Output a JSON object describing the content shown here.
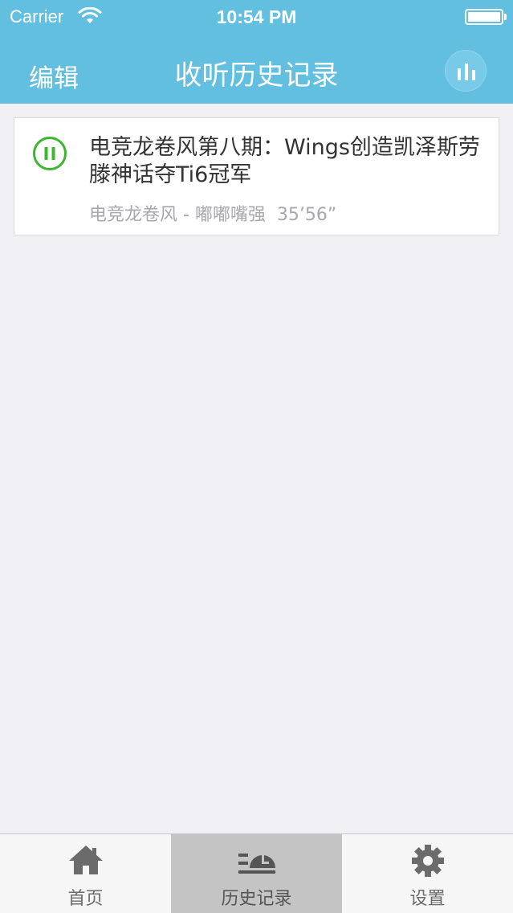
{
  "status_bar": {
    "carrier": "Carrier",
    "time": "10:54 PM"
  },
  "nav": {
    "edit_label": "编辑",
    "title": "收听历史记录",
    "player_icon": "equalizer-icon"
  },
  "history": [
    {
      "title": "电竞龙卷风第八期：Wings创造凯泽斯劳滕神话夺Ti6冠军",
      "meta": "电竞龙卷风 - 嘟嘟嘴强  35’56”",
      "icon": "pause-icon",
      "state": "playing"
    }
  ],
  "tabs": [
    {
      "label": "首页",
      "icon": "home-icon",
      "active": false
    },
    {
      "label": "历史记录",
      "icon": "history-icon",
      "active": true
    },
    {
      "label": "设置",
      "icon": "gear-icon",
      "active": false
    }
  ],
  "colors": {
    "header": "#62bfe0",
    "background": "#efeff4",
    "play_green": "#3cb72f"
  }
}
